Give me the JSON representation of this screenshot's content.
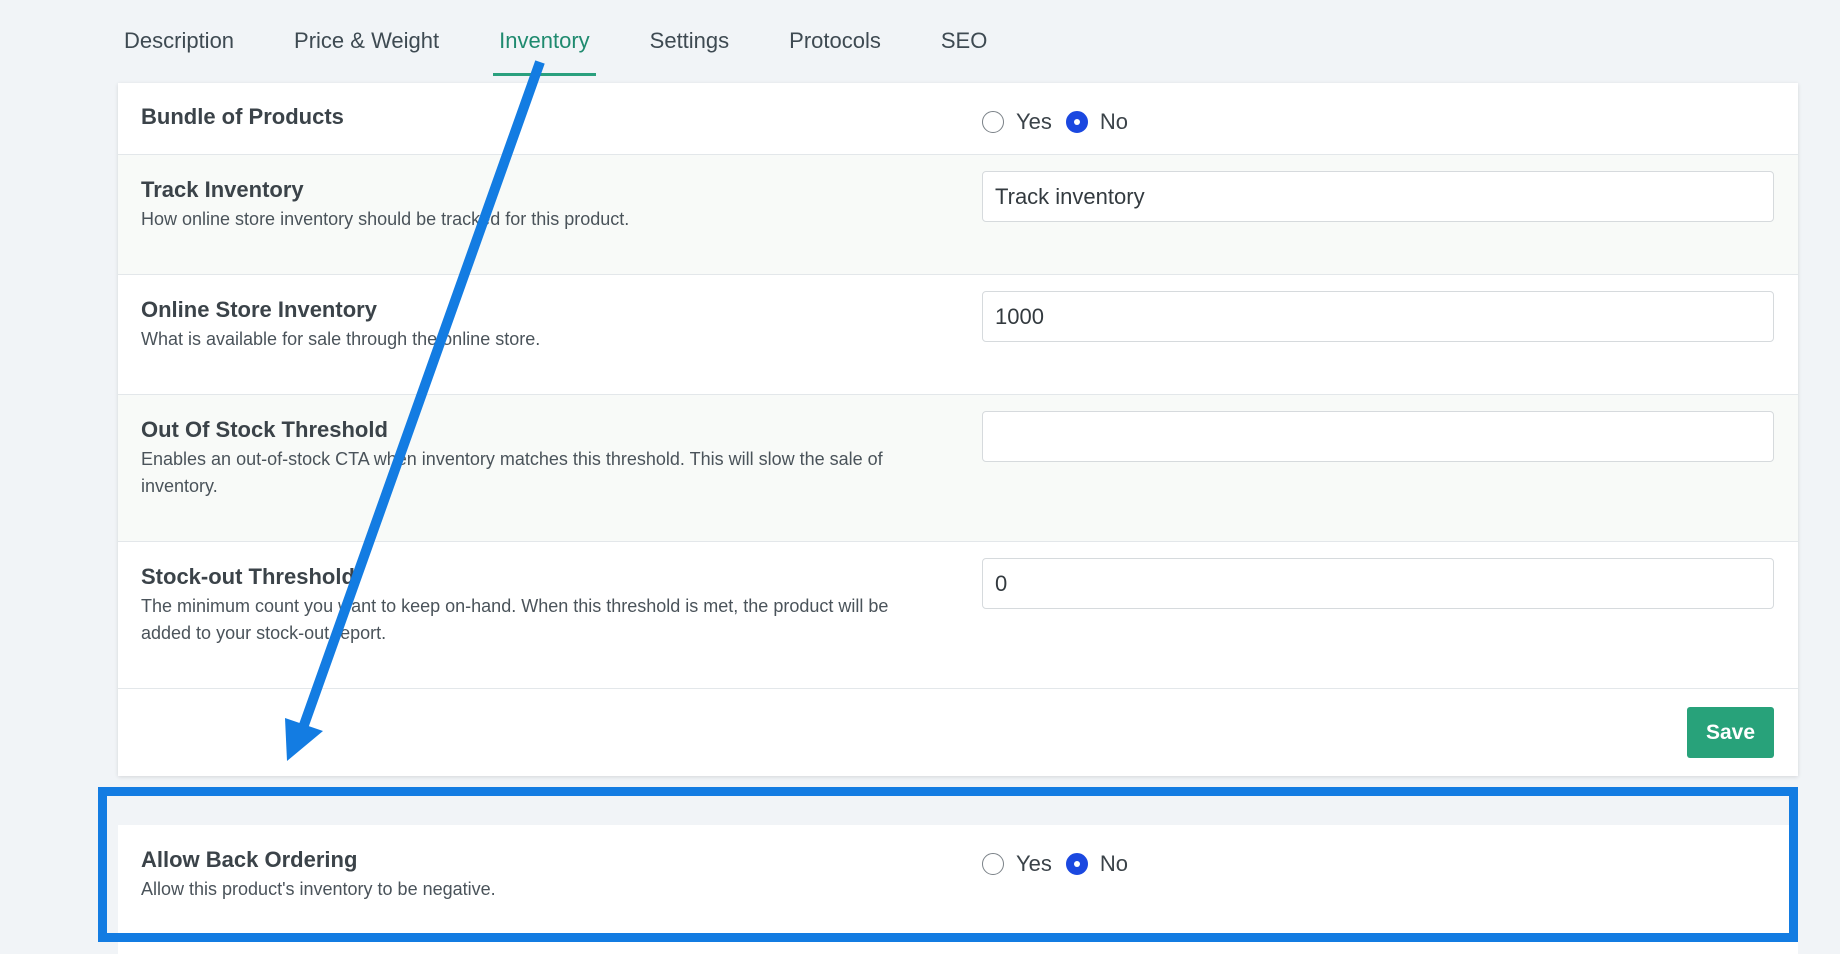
{
  "tabs": [
    {
      "label": "Description",
      "active": false
    },
    {
      "label": "Price & Weight",
      "active": false
    },
    {
      "label": "Inventory",
      "active": true
    },
    {
      "label": "Settings",
      "active": false
    },
    {
      "label": "Protocols",
      "active": false
    },
    {
      "label": "SEO",
      "active": false
    }
  ],
  "inventory": {
    "bundle": {
      "label": "Bundle of Products",
      "options": [
        "Yes",
        "No"
      ],
      "selected": "No"
    },
    "track": {
      "label": "Track Inventory",
      "description": "How online store inventory should be tracked for this product.",
      "value": "Track inventory"
    },
    "online_store": {
      "label": "Online Store Inventory",
      "description": "What is available for sale through the online store.",
      "value": "1000"
    },
    "out_of_stock": {
      "label": "Out Of Stock Threshold",
      "description": "Enables an out-of-stock CTA when inventory matches this threshold. This will slow the sale of inventory.",
      "value": ""
    },
    "stock_out": {
      "label": "Stock-out Threshold",
      "description": "The minimum count you want to keep on-hand. When this threshold is met, the product will be added to your stock-out report.",
      "value": "0"
    },
    "save_label": "Save"
  },
  "backorder": {
    "label": "Allow Back Ordering",
    "description": "Allow this product's inventory to be negative.",
    "options": [
      "Yes",
      "No"
    ],
    "selected": "No"
  },
  "colors": {
    "accent": "#2aa07e",
    "save_button": "#28a27a",
    "radio_selected": "#1b48e0",
    "annotation": "#137ce2"
  }
}
